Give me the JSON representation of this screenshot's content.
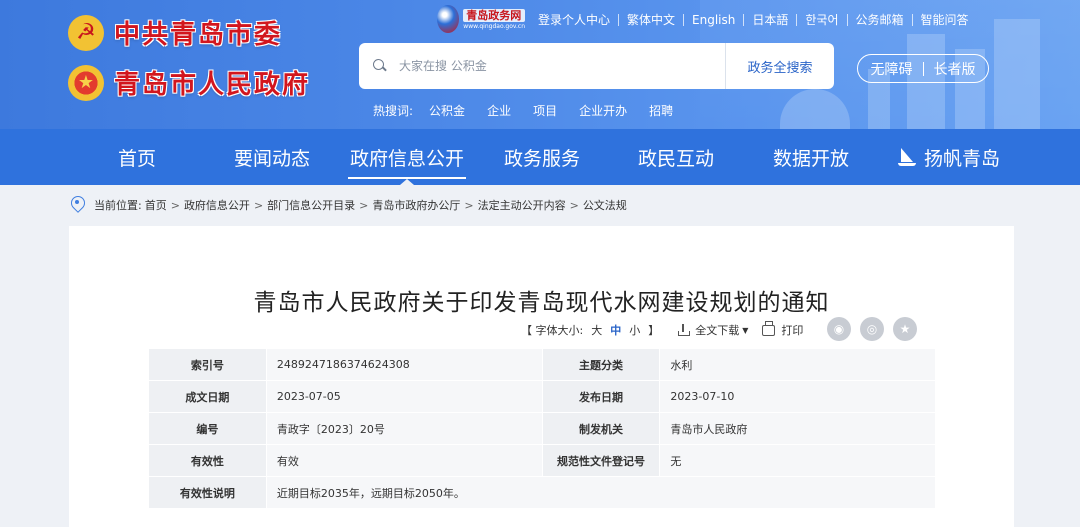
{
  "header": {
    "party_org": "中共青岛市委",
    "gov_org": "青岛市人民政府",
    "portal_logo_text": "青岛政务网",
    "portal_logo_sub": "www.qingdao.gov.cn",
    "top_links": [
      "登录个人中心",
      "繁体中文",
      "English",
      "日本語",
      "한국어",
      "公务邮箱",
      "智能问答"
    ],
    "search": {
      "placeholder": "大家在搜 公积金",
      "button_label": "政务全搜索"
    },
    "hot_words_label": "热搜词:",
    "hot_words": [
      "公积金",
      "企业",
      "项目",
      "企业开办",
      "招聘"
    ],
    "accessibility": {
      "barrier_free": "无障碍",
      "elder_version": "长者版"
    }
  },
  "nav": {
    "items": [
      "首页",
      "要闻动态",
      "政府信息公开",
      "政务服务",
      "政民互动",
      "数据开放",
      "扬帆青岛"
    ],
    "active_index": 2
  },
  "breadcrumb": {
    "prefix": "当前位置:",
    "items": [
      "首页",
      "政府信息公开",
      "部门信息公开目录",
      "青岛市政府办公厅",
      "法定主动公开内容",
      "公文法规"
    ],
    "separator": ">"
  },
  "document": {
    "title": "青岛市人民政府关于印发青岛现代水网建设规划的通知",
    "tools": {
      "font_size_open": "【 字体大小:",
      "size_large": "大",
      "size_medium": "中",
      "size_small": "小",
      "font_size_close": "】",
      "download_label": "全文下载",
      "print_label": "打印"
    },
    "share_icons": [
      "wechat-icon",
      "weibo-icon",
      "favorite-icon"
    ],
    "meta": {
      "index_no_label": "索引号",
      "index_no": "2489247186374624308",
      "topic_label": "主题分类",
      "topic": "水利",
      "created_label": "成文日期",
      "created": "2023-07-05",
      "published_label": "发布日期",
      "published": "2023-07-10",
      "doc_no_label": "编号",
      "doc_no": "青政字〔2023〕20号",
      "issuer_label": "制发机关",
      "issuer": "青岛市人民政府",
      "validity_label": "有效性",
      "validity": "有效",
      "registry_label": "规范性文件登记号",
      "registry": "无",
      "validity_note_label": "有效性说明",
      "validity_note": "近期目标2035年，远期目标2050年。"
    }
  },
  "colors": {
    "header_blue": "#3d79dd",
    "nav_blue": "#2f72dd",
    "brand_red": "#d2161e",
    "link_blue": "#2a64c8"
  }
}
